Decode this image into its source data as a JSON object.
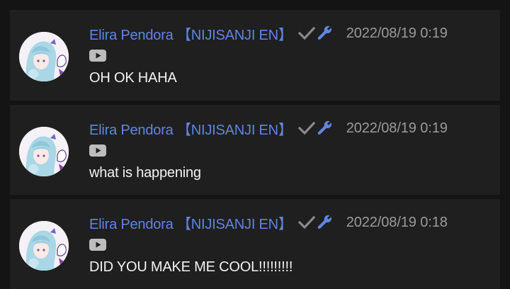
{
  "messages": [
    {
      "author": "Elira Pendora 【NIJISANJI EN】",
      "timestamp": "2022/08/19 0:19",
      "text": "OH OK HAHA",
      "badges": [
        "verified-check-icon",
        "moderator-wrench-icon"
      ],
      "platform_icon": "youtube-icon"
    },
    {
      "author": "Elira Pendora 【NIJISANJI EN】",
      "timestamp": "2022/08/19 0:19",
      "text": "what is happening",
      "badges": [
        "verified-check-icon",
        "moderator-wrench-icon"
      ],
      "platform_icon": "youtube-icon"
    },
    {
      "author": "Elira Pendora 【NIJISANJI EN】",
      "timestamp": "2022/08/19 0:18",
      "text": "DID YOU MAKE ME COOL!!!!!!!!!",
      "badges": [
        "verified-check-icon",
        "moderator-wrench-icon"
      ],
      "platform_icon": "youtube-icon"
    }
  ],
  "colors": {
    "background": "#141414",
    "card": "#1f1f1f",
    "author": "#5f86e0",
    "timestamp": "#9a9a9a",
    "text": "#f2f2f2",
    "check": "#8a8a8a",
    "wrench": "#5f86e0"
  }
}
